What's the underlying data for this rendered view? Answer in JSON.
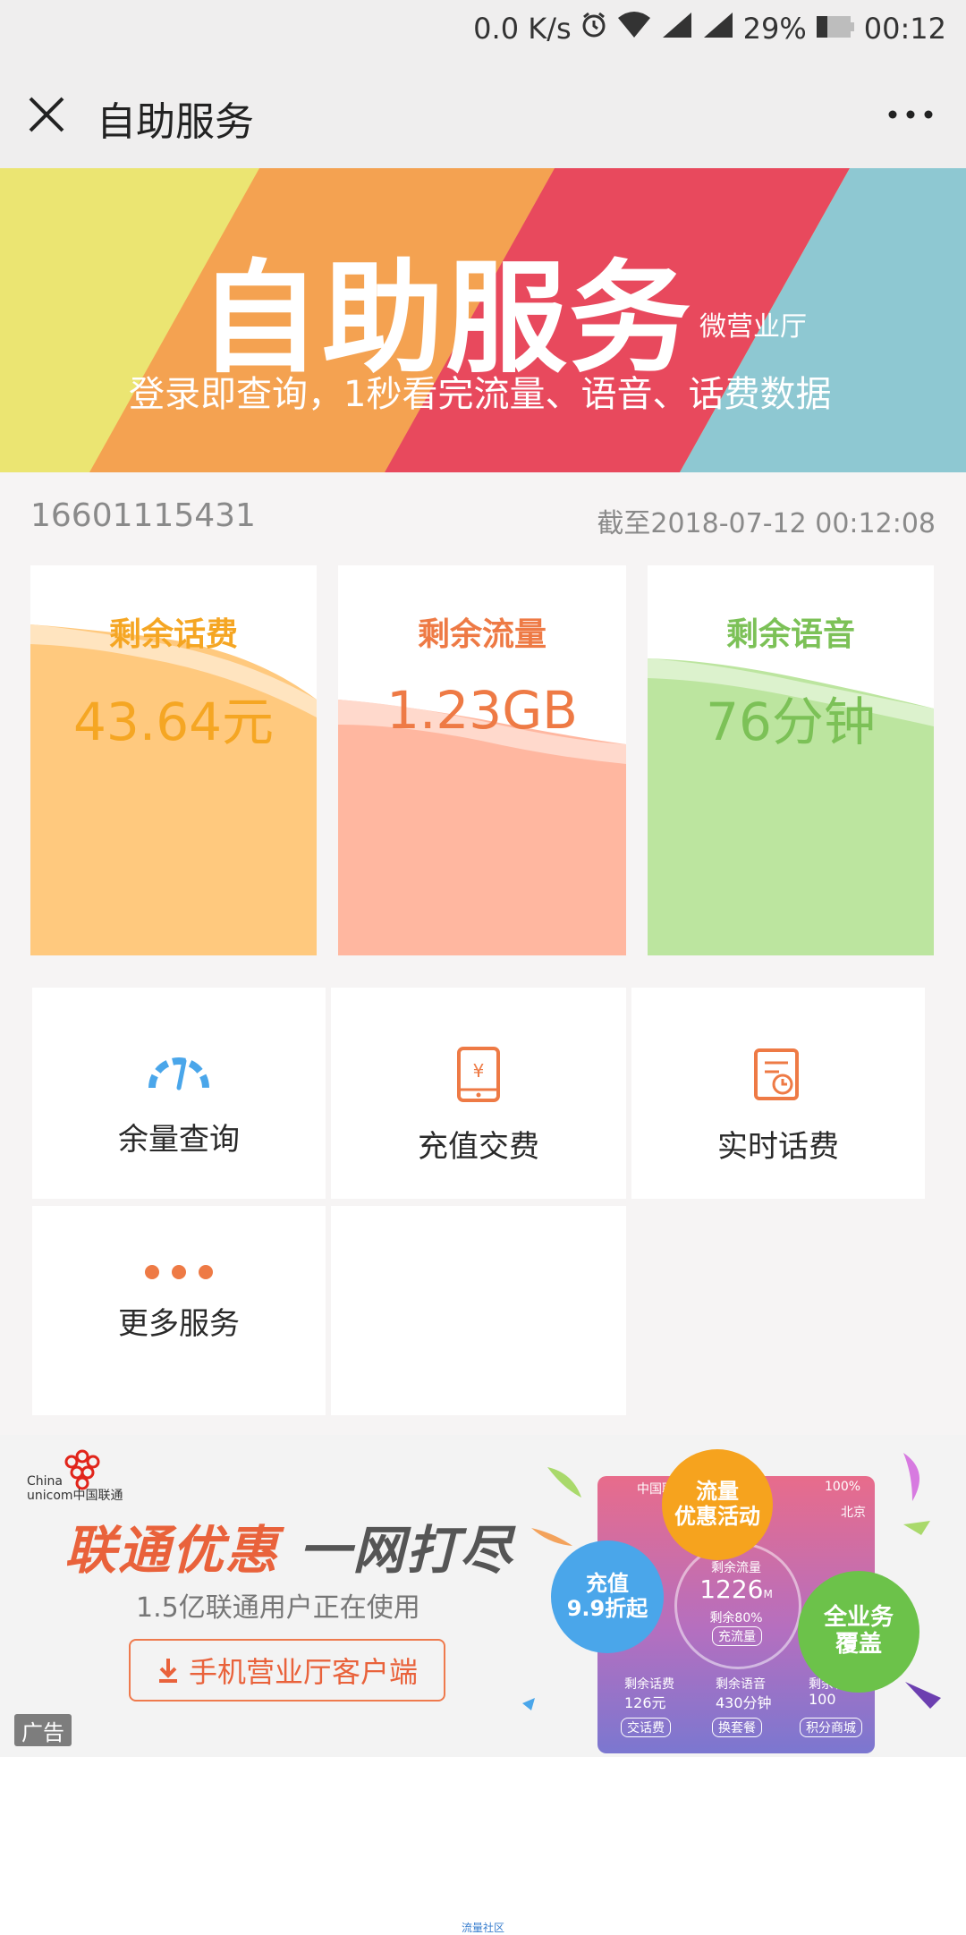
{
  "status_bar": {
    "speed": "0.0 K/s",
    "battery": "29%",
    "time": "00:12"
  },
  "titlebar": {
    "title": "自助服务",
    "close_icon": "close-icon",
    "more_icon": "more-icon"
  },
  "banner": {
    "title": "自助服务",
    "subtitle": "微营业厅",
    "description": "登录即查询，1秒看完流量、语音、话费数据",
    "colors": [
      "#ebe572",
      "#f4a251",
      "#e8495d",
      "#8ec8d2"
    ]
  },
  "account": {
    "phone": "16601115431",
    "as_of": "截至2018-07-12 00:12:08"
  },
  "balances": [
    {
      "label": "剩余话费",
      "value": "43.64元",
      "color": "#f5a623",
      "fill": "#ffc97e"
    },
    {
      "label": "剩余流量",
      "value": "1.23GB",
      "color": "#ee7a45",
      "fill": "#ffb7a0"
    },
    {
      "label": "剩余语音",
      "value": "76分钟",
      "color": "#7cc157",
      "fill": "#bce59f"
    }
  ],
  "services": [
    {
      "label": "余量查询",
      "icon": "gauge-icon"
    },
    {
      "label": "充值交费",
      "icon": "phone-yuan-icon"
    },
    {
      "label": "实时话费",
      "icon": "bill-clock-icon"
    },
    {
      "label": "更多服务",
      "icon": "more-dots-icon"
    }
  ],
  "ad": {
    "logo_text_1": "China",
    "logo_text_2": "unicom中国联通",
    "headline_1": "联通优惠",
    "headline_2": "一网打尽",
    "users": "1.5亿联通用户正在使用",
    "cta": "手机营业厅客户端",
    "tag": "广告",
    "bubbles": [
      {
        "line1": "流量",
        "line2": "优惠活动",
        "color": "#f6a31e"
      },
      {
        "line1": "充值",
        "line2": "9.9折起",
        "color": "#4aa6ea"
      },
      {
        "line1": "全业务",
        "line2": "覆盖",
        "color": "#6cc24a"
      }
    ],
    "phone_screen": {
      "carrier": "中国联通",
      "battery": "100%",
      "city": "北京",
      "remaining_label": "剩余流量",
      "remaining_value": "1226",
      "remaining_unit": "M",
      "remaining_pct": "剩余80%",
      "button": "充流量",
      "stats": [
        {
          "label": "剩余话费",
          "value": "126元",
          "button": "交话费"
        },
        {
          "label": "剩余语音",
          "value": "430分钟",
          "button": "换套餐"
        },
        {
          "label": "剩余积分",
          "value": "100",
          "button": "积分商城"
        }
      ]
    }
  },
  "footer": {
    "watermark": "流量社区"
  }
}
